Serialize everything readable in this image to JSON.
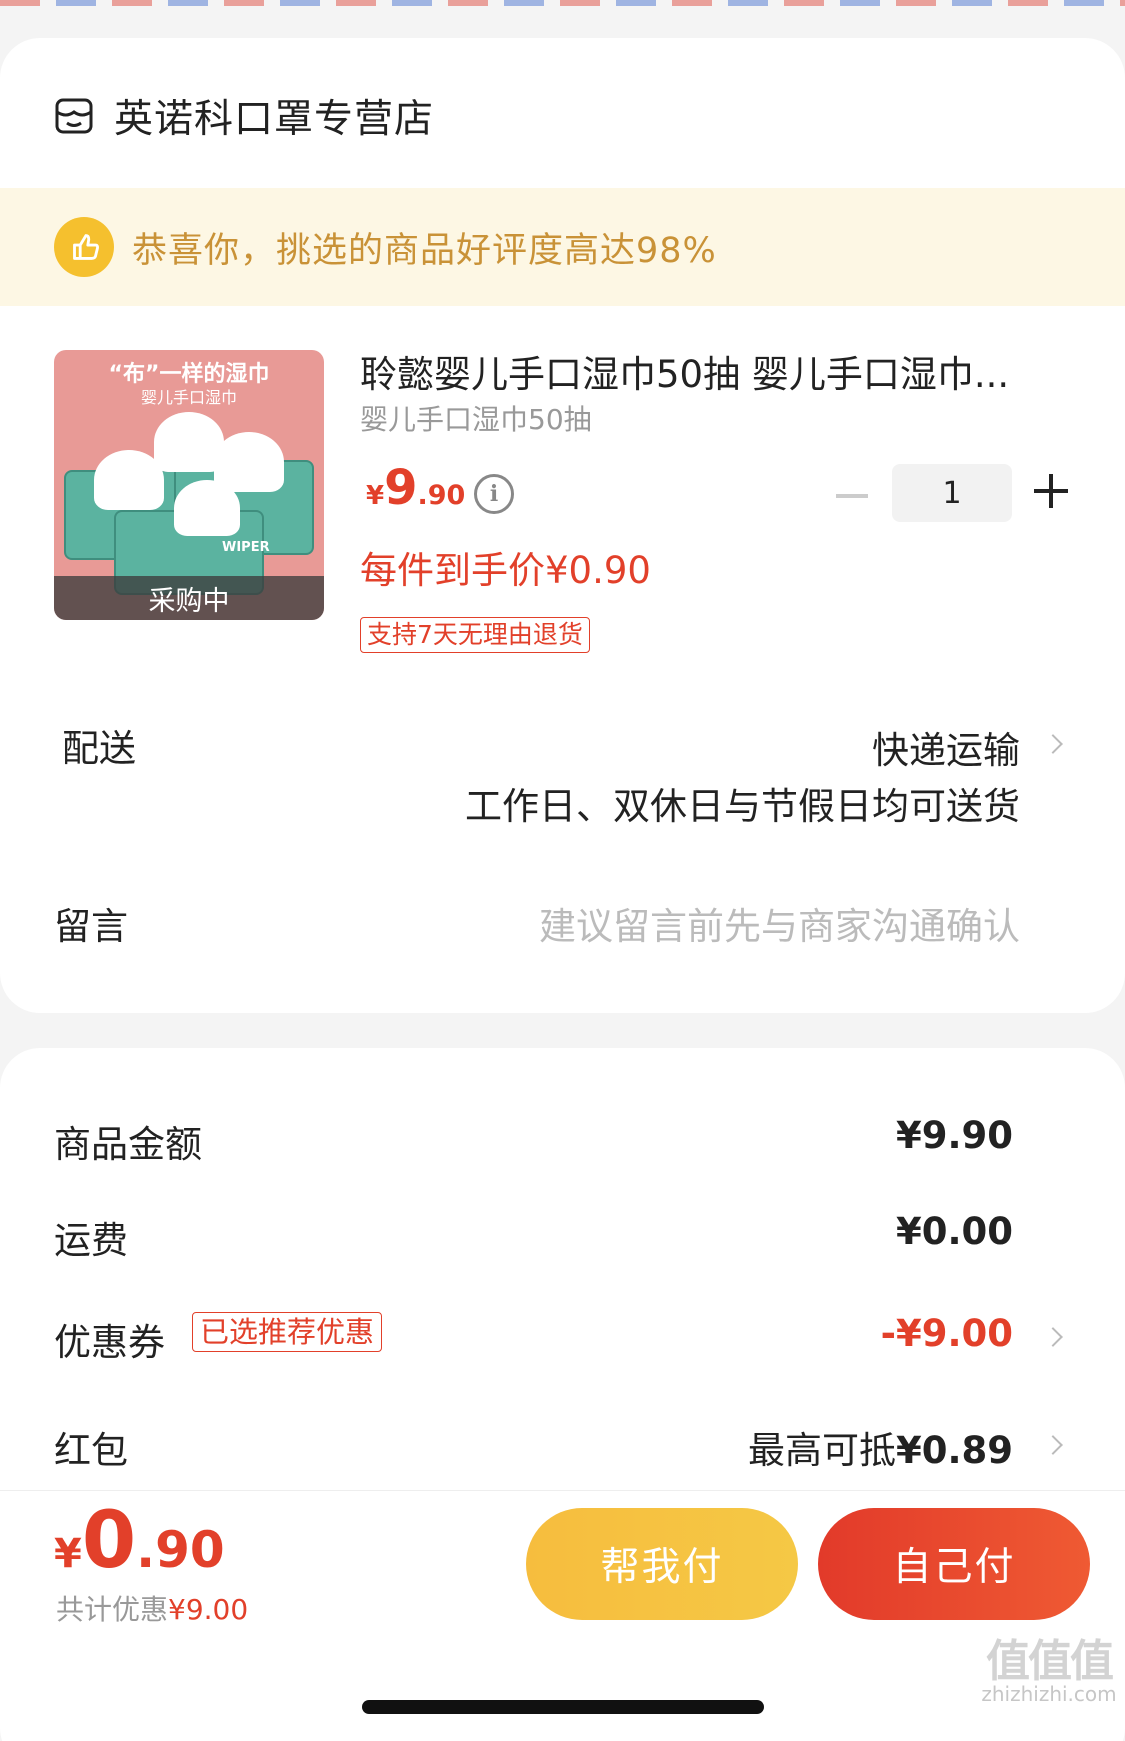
{
  "shop": {
    "name": "英诺科口罩专营店",
    "icon": "store-icon"
  },
  "banner": {
    "text": "恭喜你，挑选的商品好评度高达98%",
    "icon": "thumbs-up-icon"
  },
  "product": {
    "image_title": "“布”一样的湿巾",
    "image_subtitle": "婴儿手口湿巾",
    "pack_label": "WIPER",
    "status_overlay": "采购中",
    "title": "聆懿婴儿手口湿巾50抽 婴儿手口湿巾...",
    "spec": "婴儿手口湿巾50抽",
    "price_symbol": "¥",
    "price_int": "9",
    "price_dec": ".90",
    "unit_price": "每件到手价¥0.90",
    "return_policy": "支持7天无理由退货",
    "quantity": "1"
  },
  "delivery": {
    "label": "配送",
    "method": "快递运输",
    "note": "工作日、双休日与节假日均可送货"
  },
  "message": {
    "label": "留言",
    "placeholder": "建议留言前先与商家沟通确认"
  },
  "summary": {
    "goods_label": "商品金额",
    "goods_value": "¥9.90",
    "shipping_label": "运费",
    "shipping_value": "¥0.00",
    "coupon_label": "优惠券",
    "coupon_badge": "已选推荐优惠",
    "coupon_value": "-¥9.00",
    "hongbao_label": "红包",
    "hongbao_prefix": "最高可抵",
    "hongbao_value": "¥0.89"
  },
  "footer": {
    "total_symbol": "¥",
    "total_int": "0",
    "total_dec": ".90",
    "discount_prefix": "共计优惠",
    "discount_value": "¥9.00",
    "help_pay": "帮我付",
    "self_pay": "自己付"
  },
  "watermark": {
    "glyphs": "值值值",
    "domain": "zhizhizhi.com"
  },
  "colors": {
    "accent_red": "#e2402a",
    "banner_bg": "#fdf7e4",
    "banner_text": "#c99237",
    "help_button": "#f6bd3e",
    "self_button": "#e23a2a"
  }
}
